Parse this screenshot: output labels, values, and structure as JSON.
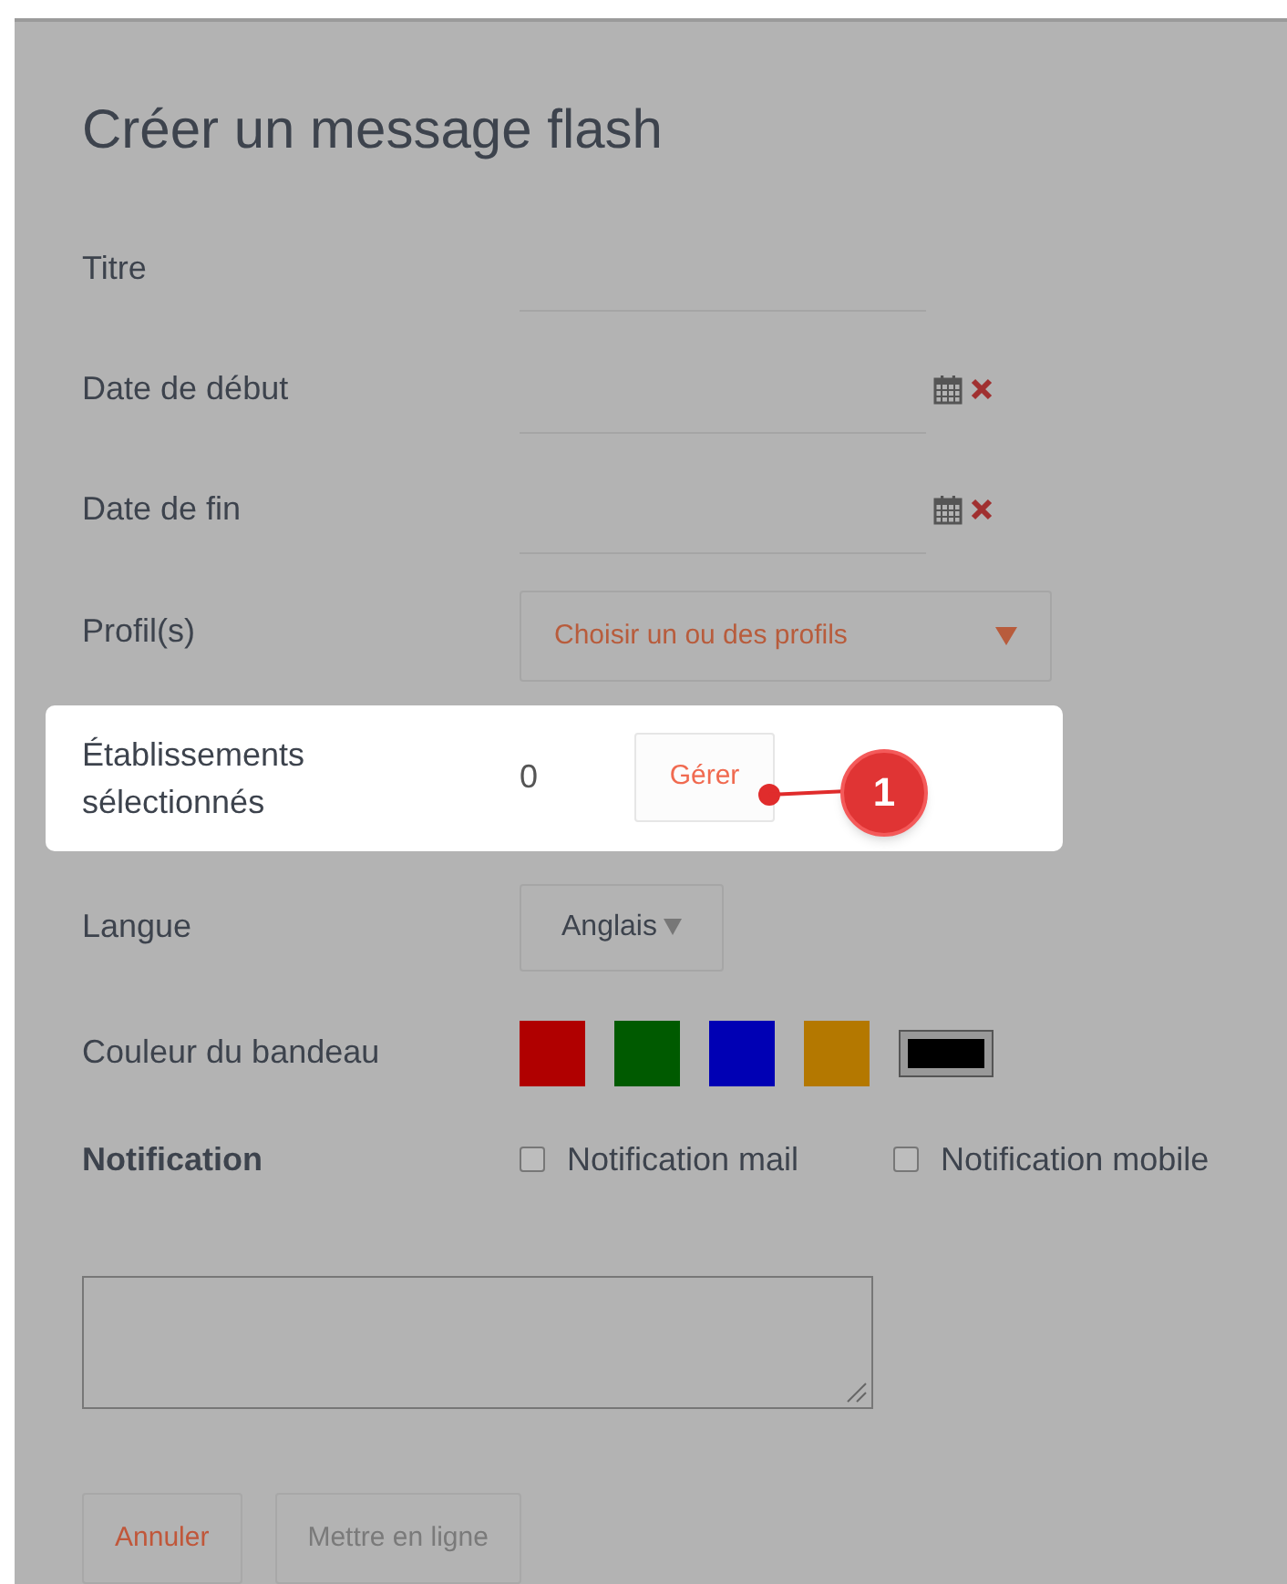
{
  "title": "Créer un message flash",
  "fields": [
    {
      "kind": "text",
      "label": "Titre"
    },
    {
      "kind": "date",
      "label": "Date de début"
    },
    {
      "kind": "date",
      "label": "Date de fin"
    },
    {
      "kind": "select",
      "label": "Profil(s)",
      "value": "Choisir un ou des profils"
    }
  ],
  "highlight": {
    "label": "Établissements sélectionnés",
    "count": "0",
    "button": "Gérer",
    "callout": "1"
  },
  "language": {
    "label": "Langue",
    "value": "Anglais"
  },
  "banner_color": {
    "label": "Couleur du bandeau",
    "swatches": [
      {
        "color": "#b00000",
        "selected": false
      },
      {
        "color": "#005a00",
        "selected": false
      },
      {
        "color": "#0000b4",
        "selected": false
      },
      {
        "color": "#b47800",
        "selected": false
      },
      {
        "color": "#000000",
        "selected": true
      }
    ]
  },
  "notification": {
    "label": "Notification",
    "options": [
      {
        "label": "Notification mail",
        "checked": false
      },
      {
        "label": "Notification mobile",
        "checked": false
      }
    ]
  },
  "buttons": [
    {
      "kind": "cancel",
      "label": "Annuler"
    },
    {
      "kind": "submit",
      "label": "Mettre en ligne"
    }
  ]
}
